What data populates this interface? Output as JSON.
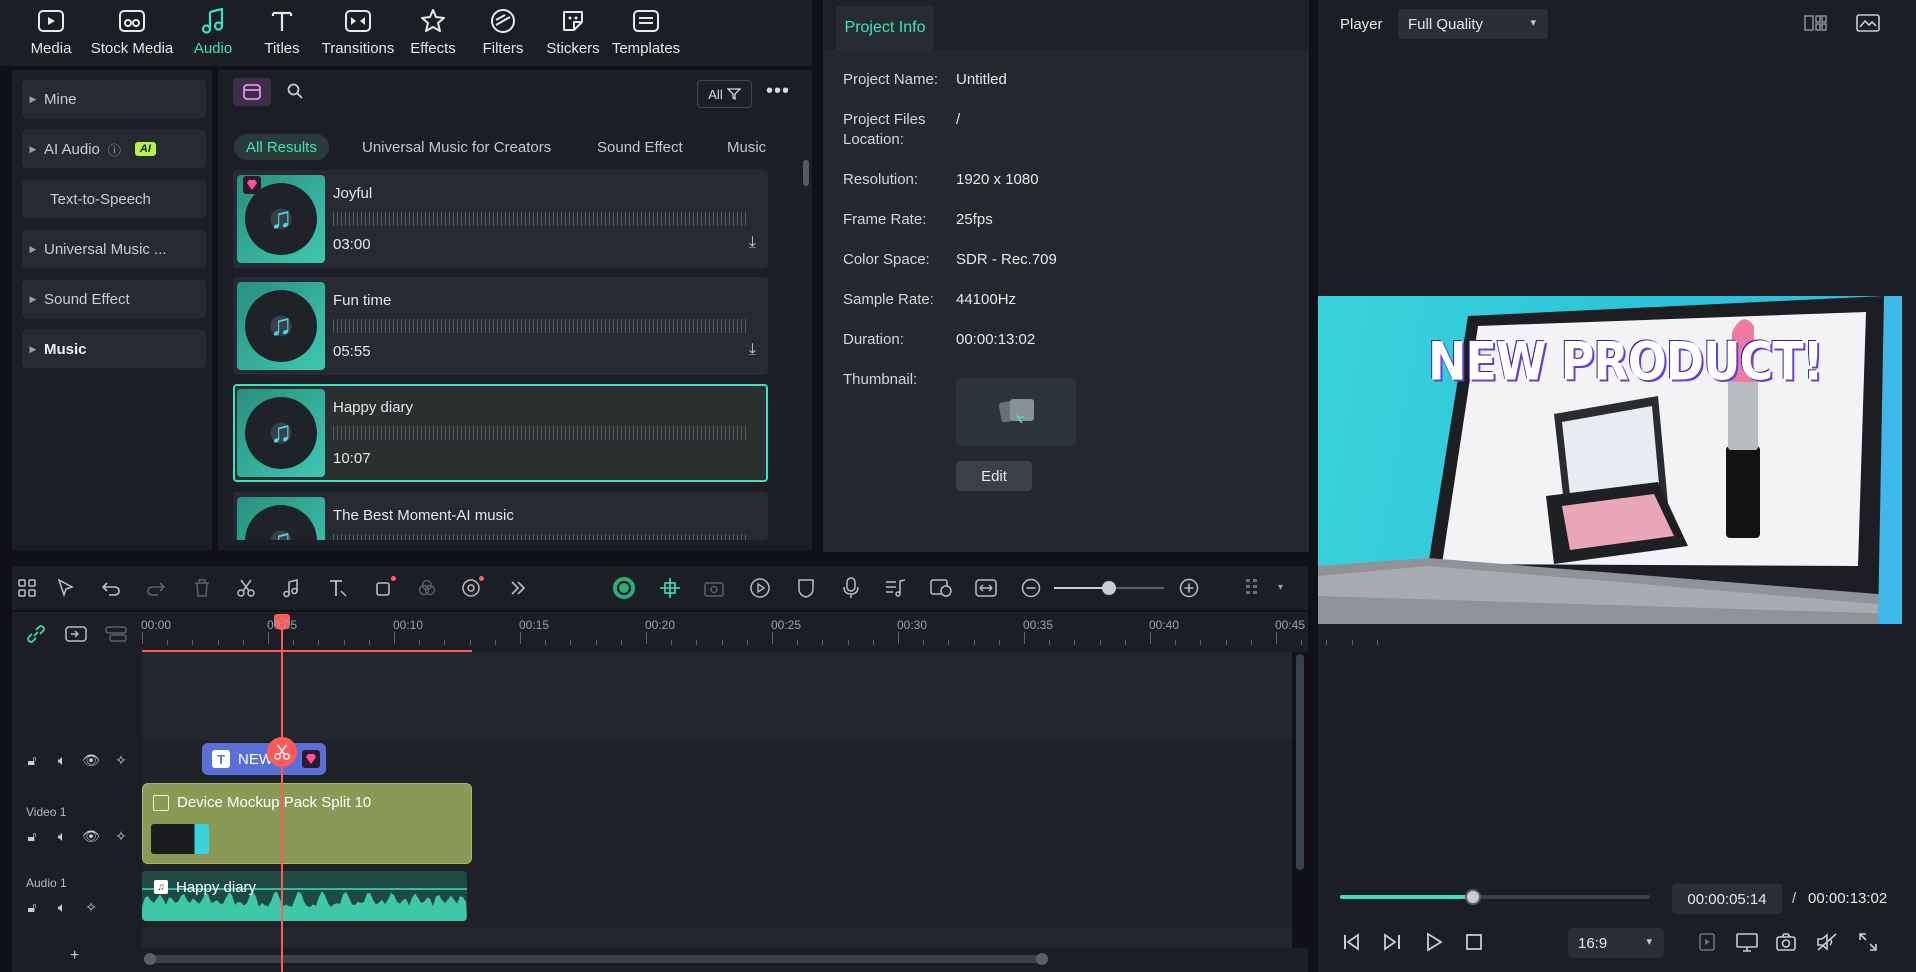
{
  "toolbar": {
    "items": [
      {
        "label": "Media",
        "icon": "media-icon"
      },
      {
        "label": "Stock Media",
        "icon": "stock-media-icon"
      },
      {
        "label": "Audio",
        "icon": "music-note-icon"
      },
      {
        "label": "Titles",
        "icon": "text-t-icon"
      },
      {
        "label": "Transitions",
        "icon": "transitions-icon"
      },
      {
        "label": "Effects",
        "icon": "effects-icon"
      },
      {
        "label": "Filters",
        "icon": "filters-icon"
      },
      {
        "label": "Stickers",
        "icon": "stickers-icon"
      },
      {
        "label": "Templates",
        "icon": "templates-icon"
      }
    ],
    "active": "Audio"
  },
  "categories": [
    {
      "label": "Mine"
    },
    {
      "label": "AI Audio",
      "badge": "AI"
    },
    {
      "label": "Text-to-Speech"
    },
    {
      "label": "Universal Music ..."
    },
    {
      "label": "Sound Effect"
    },
    {
      "label": "Music"
    }
  ],
  "audio_panel": {
    "filter_all": "All",
    "tabs": [
      "All Results",
      "Universal Music for Creators",
      "Sound Effect",
      "Music"
    ],
    "tracks": [
      {
        "name": "Joyful",
        "duration": "03:00"
      },
      {
        "name": "Fun time",
        "duration": "05:55"
      },
      {
        "name": "Happy diary",
        "duration": "10:07"
      },
      {
        "name": "The Best Moment-AI music",
        "duration": ""
      }
    ]
  },
  "project_info": {
    "tab": "Project Info",
    "name_label": "Project Name:",
    "name_value": "Untitled",
    "files_label_1": "Project Files",
    "files_label_2": "Location:",
    "files_value": "/",
    "resolution_label": "Resolution:",
    "resolution_value": "1920 x 1080",
    "framerate_label": "Frame Rate:",
    "framerate_value": "25fps",
    "colorspace_label": "Color Space:",
    "colorspace_value": "SDR - Rec.709",
    "samplerate_label": "Sample Rate:",
    "samplerate_value": "44100Hz",
    "duration_label": "Duration:",
    "duration_value": "00:00:13:02",
    "thumbnail_label": "Thumbnail:",
    "edit_button": "Edit"
  },
  "player": {
    "label": "Player",
    "quality": "Full Quality",
    "video_title": "NEW PRODUCT!",
    "current_time": "00:00:05:14",
    "separator": "/",
    "total_time": "00:00:13:02",
    "aspect_ratio": "16:9",
    "progress": 0.43
  },
  "timeline": {
    "ruler": [
      "00:00",
      "00:05",
      "00:10",
      "00:15",
      "00:20",
      "00:25",
      "00:30",
      "00:35",
      "00:40",
      "00:45"
    ],
    "title_clip": "NEW",
    "video_track_label": "Video 1",
    "video_clip": "Device Mockup Pack Split 10",
    "audio_track_label": "Audio 1",
    "audio_clip": "Happy diary",
    "add_track": "+"
  },
  "colors": {
    "accent": "#3fe0c2",
    "playhead": "#ff5a5a",
    "video_clip": "#8a9a56",
    "audio_clip": "#2f8f7a",
    "title_clip": "#5b6fd6"
  }
}
